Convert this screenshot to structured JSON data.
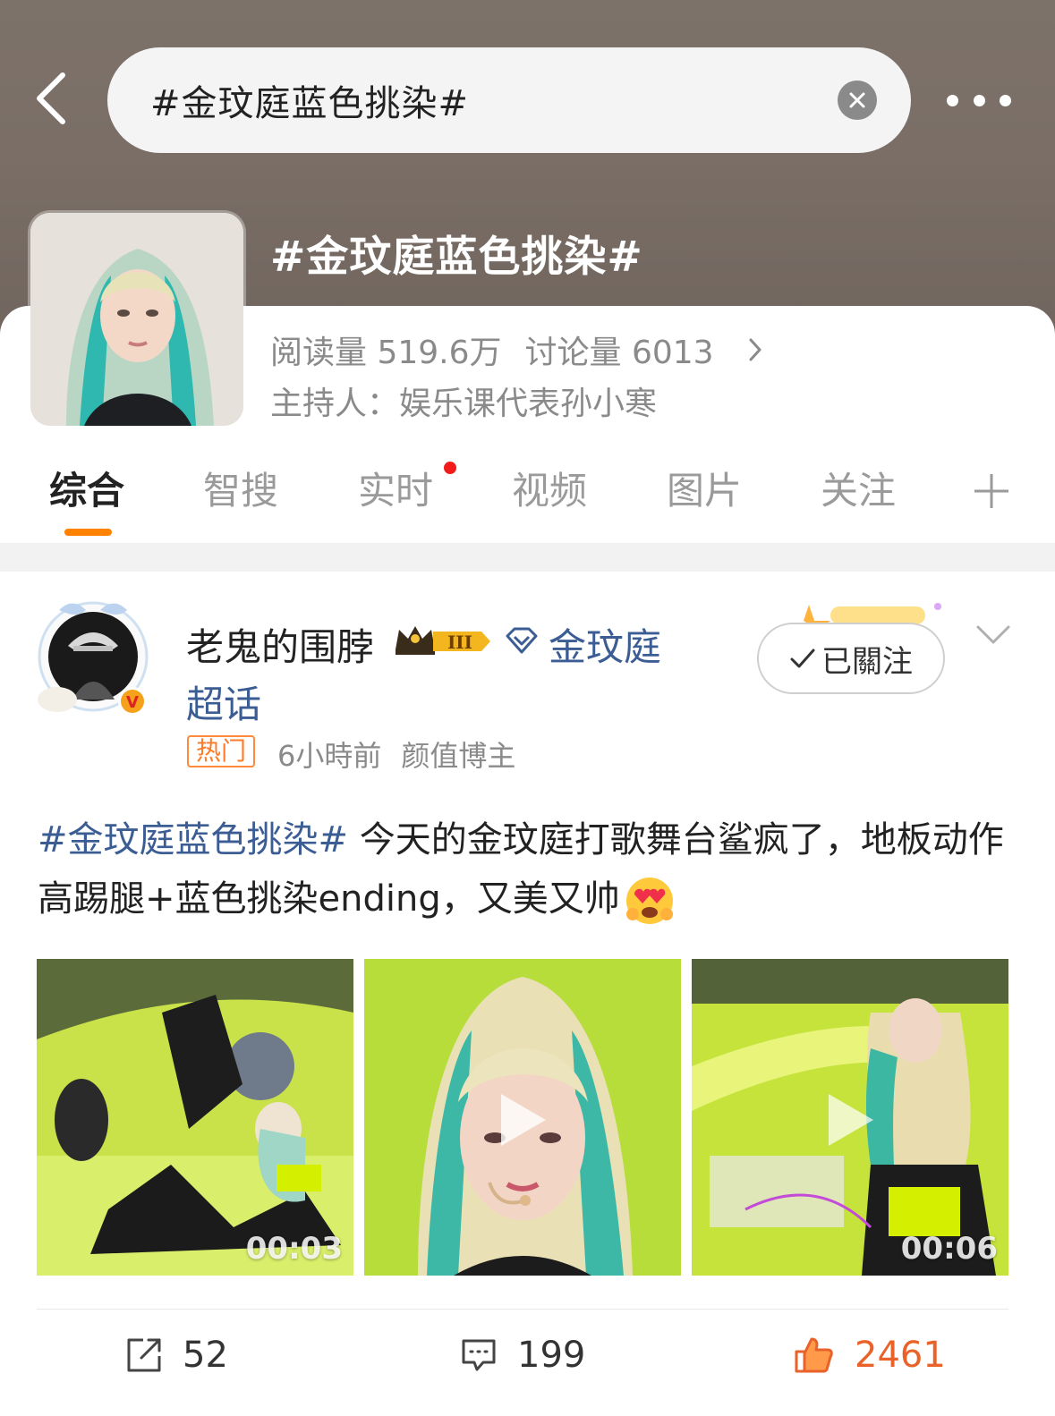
{
  "search": {
    "query": "#金玟庭蓝色挑染#"
  },
  "topic": {
    "title": "#金玟庭蓝色挑染#",
    "read_count": "阅读量 519.6万",
    "discussion_count": "讨论量 6013",
    "host": "主持人：娱乐课代表孙小寒"
  },
  "tabs": [
    {
      "label": "综合"
    },
    {
      "label": "智搜"
    },
    {
      "label": "实时"
    },
    {
      "label": "视频"
    },
    {
      "label": "图片"
    },
    {
      "label": "关注"
    }
  ],
  "post": {
    "username": "老鬼的围脖",
    "level_badge": "III",
    "super_topic_line1": "金玟庭",
    "super_topic_line2": "超话",
    "follow_label": "已關注",
    "hot_label": "热门",
    "time": "6小時前",
    "role": "颜值博主",
    "hashtag": "#金玟庭蓝色挑染#",
    "body": " 今天的金玟庭打歌舞台鲨疯了，地板动作高踢腿+蓝色挑染ending，又美又帅",
    "emoji": "heart-eyes-emoji",
    "videos": [
      {
        "duration": "00:03"
      },
      {
        "duration": ""
      },
      {
        "duration": "00:06"
      }
    ],
    "reposts": "52",
    "comments": "199",
    "likes": "2461"
  },
  "colors": {
    "accent": "#ff8200",
    "link": "#3b5d94",
    "like": "#e8622a",
    "header_bg": "#7a6e66"
  }
}
